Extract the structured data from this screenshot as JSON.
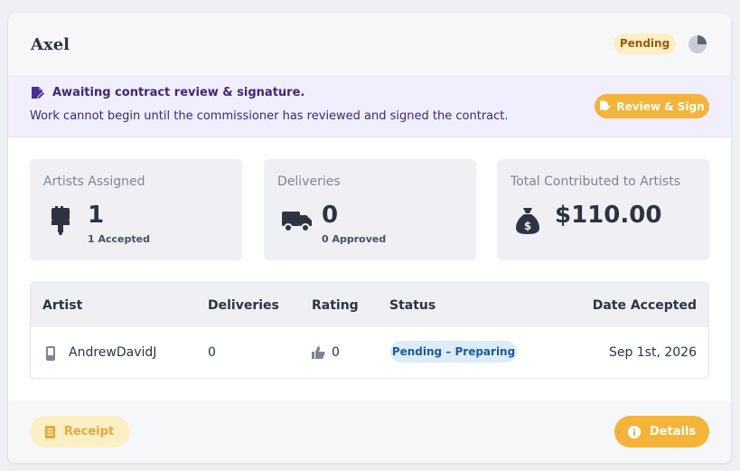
{
  "header": {
    "title": "Axel",
    "status_badge": "Pending"
  },
  "banner": {
    "title": "Awaiting contract review & signature.",
    "text": "Work cannot begin until the commissioner has reviewed and signed the contract.",
    "review_button": "Review & Sign"
  },
  "stats": [
    {
      "label": "Artists Assigned",
      "value": "1",
      "sub": "1 Accepted",
      "icon": "paintbrush-icon"
    },
    {
      "label": "Deliveries",
      "value": "0",
      "sub": "0 Approved",
      "icon": "truck-icon"
    },
    {
      "label": "Total Contributed to Artists",
      "value": "$110.00",
      "icon": "money-bag-icon"
    }
  ],
  "table": {
    "headers": [
      "Artist",
      "Deliveries",
      "Rating",
      "Status",
      "Date Accepted"
    ],
    "rows": [
      {
        "artist": "AndrewDavidJ",
        "deliveries": "0",
        "rating": "0",
        "status": "Pending – Preparing",
        "date": "Sep 1st, 2026"
      }
    ]
  },
  "footer": {
    "receipt_button": "Receipt",
    "details_button": "Details"
  },
  "colors": {
    "accent": "#f4b43a",
    "banner_bg": "#f1eefd",
    "status_pill_bg": "#dcecf9"
  }
}
